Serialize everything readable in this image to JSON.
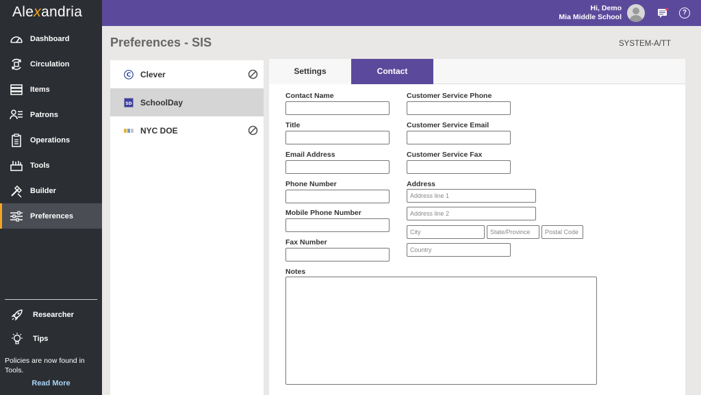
{
  "app": {
    "logo_pre": "Ale",
    "logo_x": "x",
    "logo_post": "andria"
  },
  "nav": {
    "items": [
      {
        "label": "Dashboard",
        "icon": "dashboard-gauge-icon"
      },
      {
        "label": "Circulation",
        "icon": "circulation-icon"
      },
      {
        "label": "Items",
        "icon": "items-books-icon"
      },
      {
        "label": "Patrons",
        "icon": "patrons-icon"
      },
      {
        "label": "Operations",
        "icon": "operations-clipboard-icon"
      },
      {
        "label": "Tools",
        "icon": "tools-icon"
      },
      {
        "label": "Builder",
        "icon": "builder-icon"
      },
      {
        "label": "Preferences",
        "icon": "preferences-sliders-icon",
        "active": true
      }
    ],
    "researcher": "Researcher",
    "tips": "Tips",
    "policy_note": "Policies are now found in Tools.",
    "read_more": "Read More"
  },
  "header": {
    "greeting": "Hi, Demo",
    "school": "Mia Middle School"
  },
  "page": {
    "title": "Preferences - SIS",
    "system": "SYSTEM-A/TT"
  },
  "providers": [
    {
      "name": "Clever",
      "disabled": true
    },
    {
      "name": "SchoolDay",
      "disabled": false,
      "selected": true
    },
    {
      "name": "NYC DOE",
      "disabled": true
    }
  ],
  "tabs": {
    "settings": "Settings",
    "contact": "Contact"
  },
  "form": {
    "contact_name": {
      "label": "Contact Name",
      "value": ""
    },
    "title": {
      "label": "Title",
      "value": ""
    },
    "email": {
      "label": "Email Address",
      "value": ""
    },
    "phone": {
      "label": "Phone Number",
      "value": ""
    },
    "mobile": {
      "label": "Mobile Phone Number",
      "value": ""
    },
    "fax": {
      "label": "Fax Number",
      "value": ""
    },
    "cs_phone": {
      "label": "Customer Service Phone",
      "value": ""
    },
    "cs_email": {
      "label": "Customer Service Email",
      "value": ""
    },
    "cs_fax": {
      "label": "Customer Service Fax",
      "value": ""
    },
    "address": {
      "label": "Address",
      "line1_placeholder": "Address line 1",
      "line2_placeholder": "Address line 2",
      "city_placeholder": "City",
      "state_placeholder": "State/Province",
      "postal_placeholder": "Postal Code",
      "country_placeholder": "Country"
    },
    "notes": {
      "label": "Notes",
      "value": ""
    }
  },
  "colors": {
    "accent": "#5b4a9c",
    "sidebar": "#2b2e33",
    "highlight": "#f3a623"
  }
}
